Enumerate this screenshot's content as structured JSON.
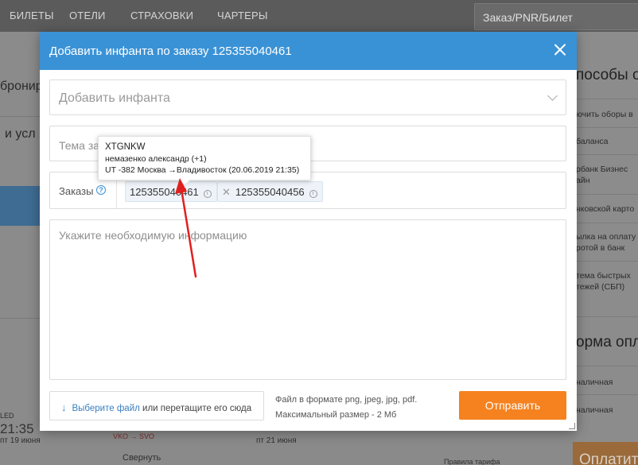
{
  "topnav": {
    "items": [
      "БИЛЕТЫ",
      "ОТЕЛИ",
      "СТРАХОВКИ",
      "ЧАРТЕРЫ"
    ],
    "pnr_placeholder": "Заказ/PNR/Билет"
  },
  "background_left": {
    "frag1": "бронир",
    "frag2": "и усл"
  },
  "background_right": {
    "heading": "пособы оп",
    "items": [
      "ючить оборы в",
      "баланса",
      "рбанк Бизнес",
      "айн",
      "нковской карто",
      "ылка на оплату",
      "ротой в банк",
      "тема быстрых",
      "тежей (СБП)"
    ],
    "heading2": "орма опл",
    "pay1": "наличная",
    "pay2": "наличная",
    "button": "Оплатить"
  },
  "background_bottom": {
    "led": "LED",
    "time": "21:35",
    "date_left": "пт 19 июня",
    "route": "VKO → SVO",
    "date_right": "пт 21 июня",
    "collapse": "Свернуть",
    "tariff": "Правила тарифа"
  },
  "modal": {
    "title": "Добавить инфанта по заказу 125355040461",
    "select_placeholder": "Добавить инфанта",
    "subject_placeholder": "Тема за",
    "orders_label": "Заказы",
    "help_glyph": "?",
    "order_tags": [
      "125355040461",
      "125355040456"
    ],
    "tag_remove_glyph": "✕",
    "info_glyph": "i",
    "message_placeholder": "Укажите необходимую информацию",
    "file": {
      "arrow_glyph": "↓",
      "link": "Выберите файл",
      "text": " или перетащите его сюда",
      "hint_line1": "Файл в формате png, jpeg, jpg, pdf.",
      "hint_line2": "Максимальный размер - 2 Мб"
    },
    "submit_label": "Отправить"
  },
  "tooltip": {
    "line1": "XTGNKW",
    "line2": "немазенко александр (+1)",
    "line3": "UT -382 Москва →Владивосток (20.06.2019 21:35)"
  },
  "colors": {
    "header_blue": "#3a92d6",
    "submit_orange": "#f5821f",
    "annotation_red": "#e0201e"
  },
  "icons": {
    "close": "close-icon",
    "chevron": "chevron-down-icon",
    "help": "question-circle-icon",
    "info": "info-circle-icon",
    "upload": "arrow-down-icon"
  }
}
